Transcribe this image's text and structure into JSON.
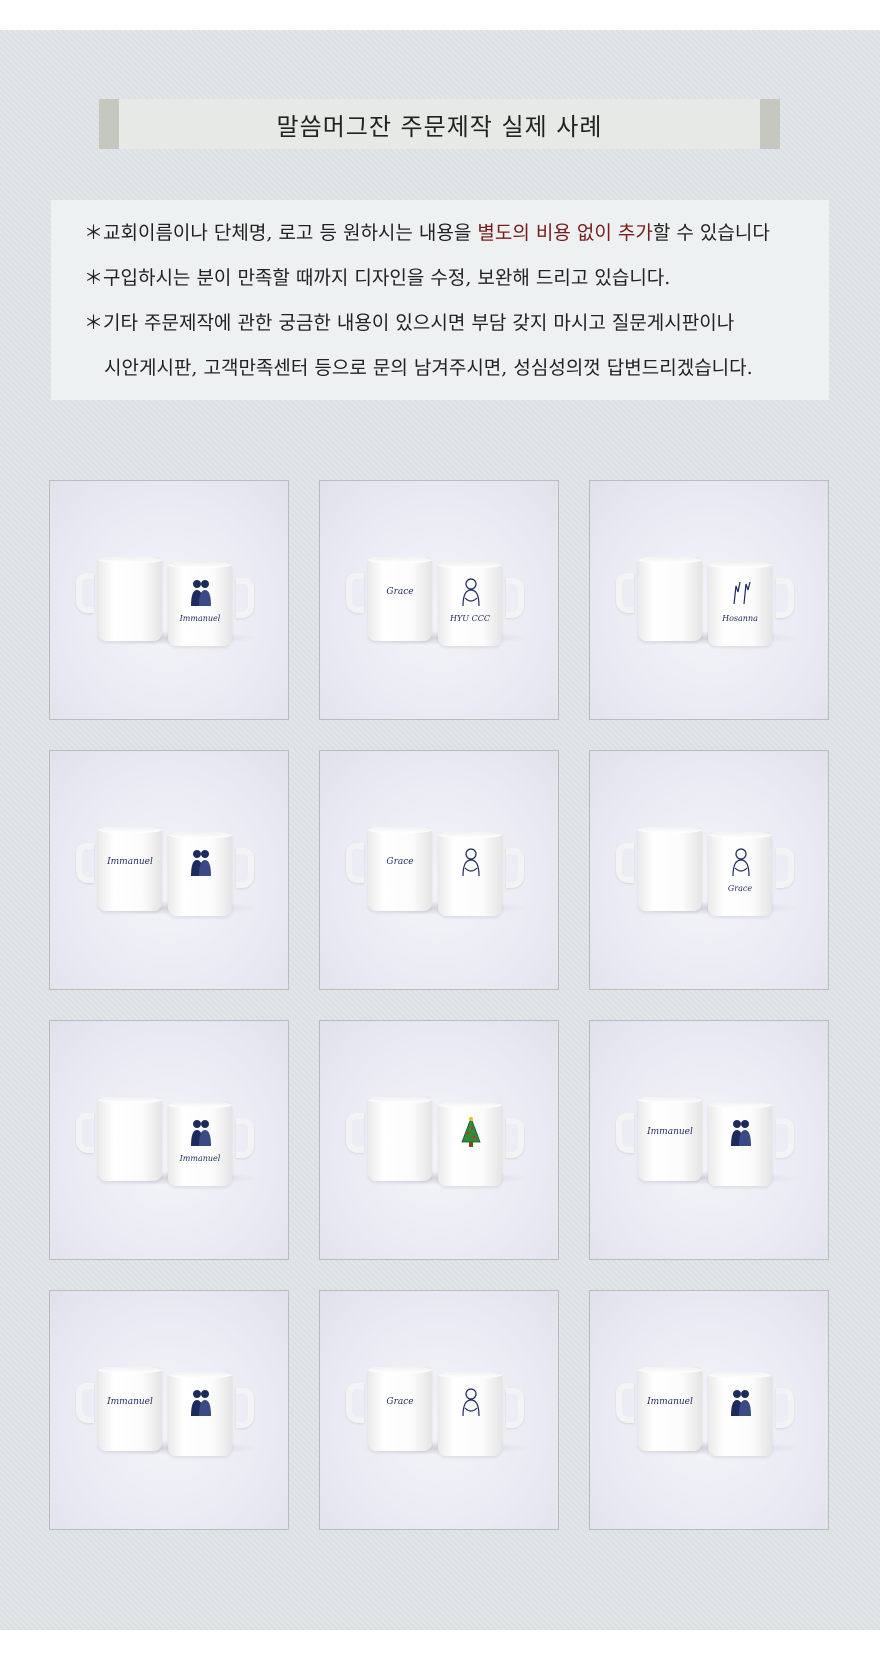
{
  "title": "말씀머그잔 주문제작 실제 사례",
  "notice": {
    "line1_prefix": "＊교회이름이나 단체명, 로고 등 원하시는 내용을 ",
    "line1_accent": "별도의 비용 없이 추가",
    "line1_suffix": "할 수 있습니다",
    "line2": "＊구입하시는 분이 만족할 때까지 디자인을 수정, 보완해 드리고 있습니다.",
    "line3": "＊기타 주문제작에 관한 궁금한 내용이 있으시면 부담 갖지 마시고 질문게시판이나",
    "line4": "시안게시판, 고객만족센터 등으로 문의 남겨주시면, 성심성의껏 답변드리겠습니다.",
    "accent_color": "#7a1b1b"
  },
  "gallery": [
    {
      "left": "",
      "right_figure": "couple",
      "right_text": "Immanuel"
    },
    {
      "left": "Grace",
      "right_figure": "hug",
      "right_text": "HYU CCC"
    },
    {
      "left": "",
      "right_figure": "hands",
      "right_text": "Hosanna"
    },
    {
      "left": "Immanuel",
      "right_figure": "couple",
      "right_text": ""
    },
    {
      "left": "Grace",
      "right_figure": "hug",
      "right_text": ""
    },
    {
      "left": "",
      "right_figure": "hug",
      "right_text": "Grace"
    },
    {
      "left": "",
      "right_figure": "couple",
      "right_text": "Immanuel"
    },
    {
      "left": "",
      "right_figure": "tree",
      "right_text": ""
    },
    {
      "left": "Immanuel",
      "right_figure": "couple",
      "right_text": ""
    },
    {
      "left": "Immanuel",
      "right_figure": "couple",
      "right_text": ""
    },
    {
      "left": "Grace",
      "right_figure": "hug",
      "right_text": ""
    },
    {
      "left": "Immanuel",
      "right_figure": "couple",
      "right_text": ""
    }
  ]
}
